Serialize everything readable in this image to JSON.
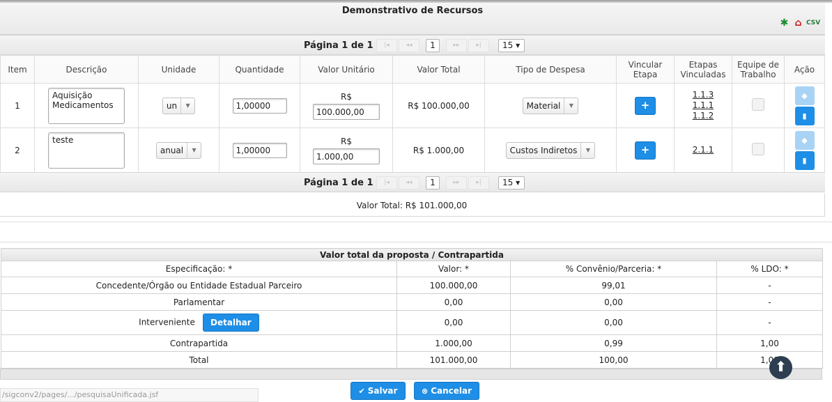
{
  "panel": {
    "title": "Demonstrativo de Recursos",
    "export_icons": [
      "excel-icon",
      "pdf-icon",
      "csv-icon"
    ]
  },
  "paginator": {
    "text": "Página 1 de 1",
    "first": "|◂",
    "prev": "◂◂",
    "page": "1",
    "next": "▸▸",
    "last": "▸|",
    "rows_per_page": "15 ▾"
  },
  "columns": [
    "Item",
    "Descrição",
    "Unidade",
    "Quantidade",
    "Valor Unitário",
    "Valor Total",
    "Tipo de Despesa",
    "Vincular Etapa",
    "Etapas Vinculadas",
    "Equipe de Trabalho",
    "Ação"
  ],
  "rows": [
    {
      "item": "1",
      "descricao": "Aquisição Medicamentos",
      "unidade": "un",
      "quantidade": "1,00000",
      "valor_unitario_label": "R$",
      "valor_unitario": "100.000,00",
      "valor_total": "R$ 100.000,00",
      "tipo_despesa": "Material",
      "vincular_label": "+",
      "etapas": [
        "1.1.3",
        "1.1.1",
        "1.1.2"
      ]
    },
    {
      "item": "2",
      "descricao": "teste",
      "unidade": "anual",
      "quantidade": "1,00000",
      "valor_unitario_label": "R$",
      "valor_unitario": "1.000,00",
      "valor_total": "R$ 1.000,00",
      "tipo_despesa": "Custos Indiretos",
      "vincular_label": "+",
      "etapas": [
        "2.1.1"
      ]
    }
  ],
  "valor_total": "Valor Total: R$ 101.000,00",
  "summary": {
    "title": "Valor total da proposta / Contrapartida",
    "headers": [
      "Especificação: *",
      "Valor: *",
      "% Convênio/Parceria: *",
      "% LDO: *"
    ],
    "rows": [
      [
        "Concedente/Órgão ou Entidade Estadual Parceiro",
        "100.000,00",
        "99,01",
        "-"
      ],
      [
        "Parlamentar",
        "0,00",
        "0,00",
        "-"
      ],
      [
        "Interveniente",
        "0,00",
        "0,00",
        "-"
      ],
      [
        "Contrapartida",
        "1.000,00",
        "0,99",
        "1,00"
      ],
      [
        "Total",
        "101.000,00",
        "100,00",
        "1,00"
      ]
    ],
    "detalhar_label": "Detalhar"
  },
  "actions": {
    "salvar": "Salvar",
    "cancelar": "Cancelar"
  },
  "status_url": "/sigconv2/pages/.../pesquisaUnificada.jsf"
}
